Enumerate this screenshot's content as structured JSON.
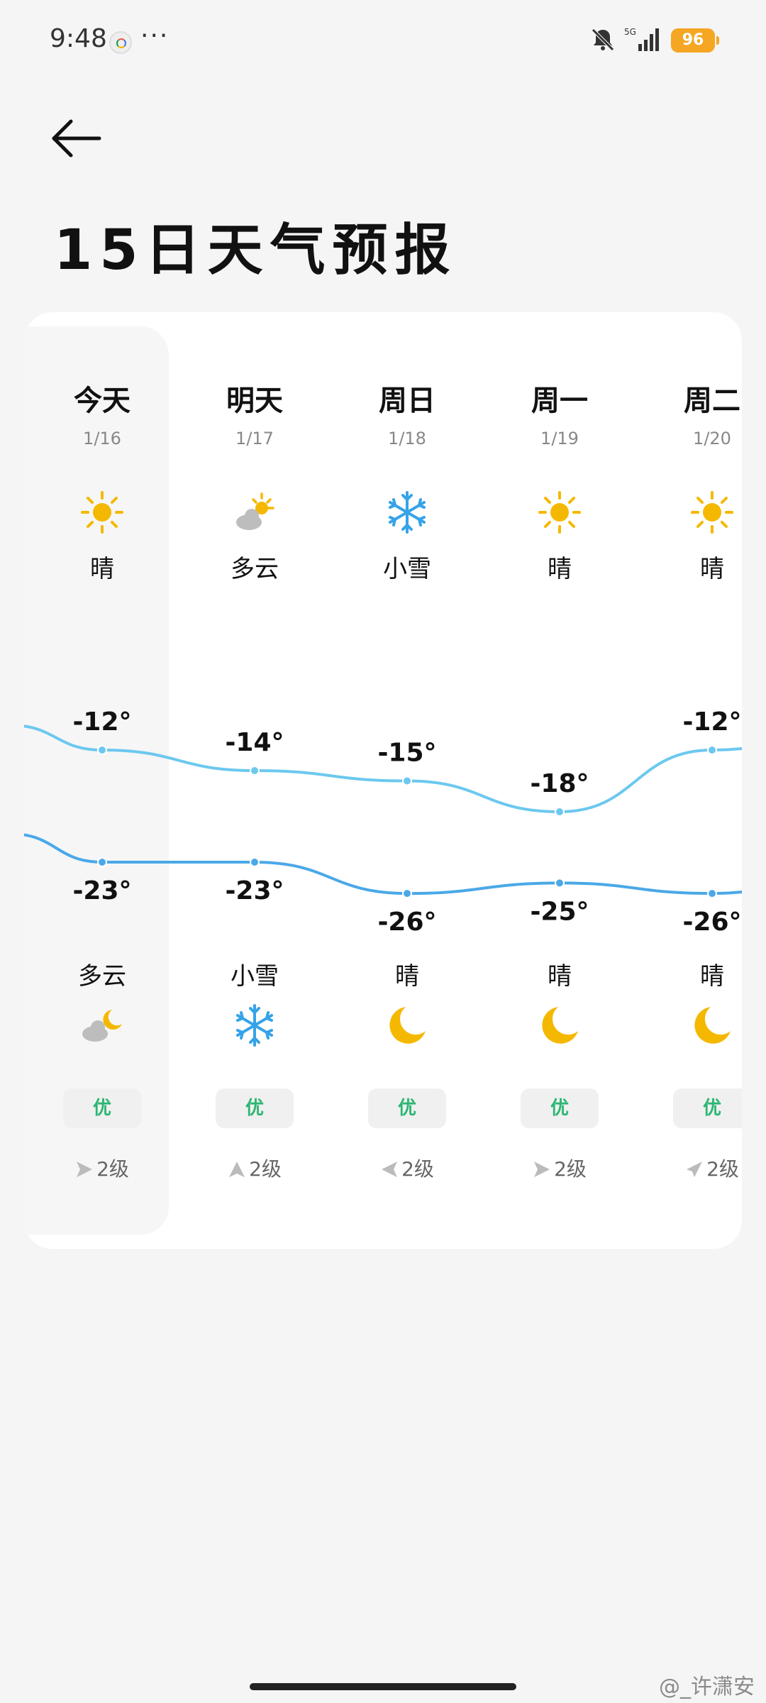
{
  "status_bar": {
    "time": "9:48",
    "more": "···",
    "network": "5G",
    "battery": "96"
  },
  "header": {
    "title": "15日天气预报"
  },
  "forecast": {
    "days": [
      {
        "name": "今天",
        "date": "1/16",
        "day_weather": "晴",
        "day_icon": "sun-icon",
        "high": -12,
        "high_label": "-12°",
        "low": -23,
        "low_label": "-23°",
        "night_weather": "多云",
        "night_icon": "cloudy-night-icon",
        "aqi": "优",
        "wind_dir": "east",
        "wind_level": "2级"
      },
      {
        "name": "明天",
        "date": "1/17",
        "day_weather": "多云",
        "day_icon": "partly-cloudy-icon",
        "high": -14,
        "high_label": "-14°",
        "low": -23,
        "low_label": "-23°",
        "night_weather": "小雪",
        "night_icon": "snowflake-icon",
        "aqi": "优",
        "wind_dir": "north",
        "wind_level": "2级"
      },
      {
        "name": "周日",
        "date": "1/18",
        "day_weather": "小雪",
        "day_icon": "snowflake-icon",
        "high": -15,
        "high_label": "-15°",
        "low": -26,
        "low_label": "-26°",
        "night_weather": "晴",
        "night_icon": "moon-icon",
        "aqi": "优",
        "wind_dir": "west",
        "wind_level": "2级"
      },
      {
        "name": "周一",
        "date": "1/19",
        "day_weather": "晴",
        "day_icon": "sun-icon",
        "high": -18,
        "high_label": "-18°",
        "low": -25,
        "low_label": "-25°",
        "night_weather": "晴",
        "night_icon": "moon-icon",
        "aqi": "优",
        "wind_dir": "east",
        "wind_level": "2级"
      },
      {
        "name": "周二",
        "date": "1/20",
        "day_weather": "晴",
        "day_icon": "sun-icon",
        "high": -12,
        "high_label": "-12°",
        "low": -26,
        "low_label": "-26°",
        "night_weather": "晴",
        "night_icon": "moon-icon",
        "aqi": "优",
        "wind_dir": "southwest",
        "wind_level": "2级"
      }
    ]
  },
  "colors": {
    "high_line": "#6cc8ef",
    "low_line": "#4aa8e8",
    "sun": "#f5b800",
    "aqi": "#2bb673",
    "battery": "#f5a623"
  },
  "watermark": "@_许潇安"
}
